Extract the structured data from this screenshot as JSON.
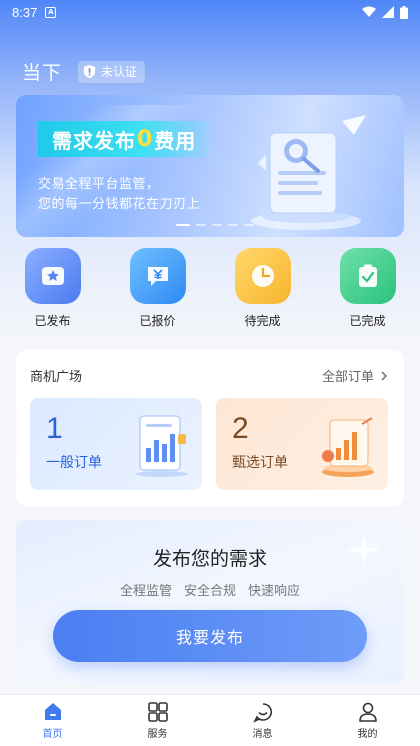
{
  "status_bar": {
    "time": "8:37",
    "badge": "A"
  },
  "header": {
    "title": "当下",
    "cert_label": "未认证"
  },
  "banner": {
    "headline_prefix": "需求发布",
    "headline_zero": "0",
    "headline_suffix": "费用",
    "line1": "交易全程平台监管，",
    "line2": "您的每一分钱都花在刀刃上"
  },
  "quick_actions": [
    {
      "label": "已发布",
      "icon": "star-box-icon"
    },
    {
      "label": "已报价",
      "icon": "yuan-chat-icon"
    },
    {
      "label": "待完成",
      "icon": "clock-icon"
    },
    {
      "label": "已完成",
      "icon": "checked-clipboard-icon"
    }
  ],
  "market": {
    "title": "商机广场",
    "all_orders": "全部订单",
    "general": {
      "count": "1",
      "label": "一般订单"
    },
    "select": {
      "count": "2",
      "label": "甄选订单"
    }
  },
  "publish": {
    "title": "发布您的需求",
    "tags": [
      "全程监管",
      "安全合规",
      "快速响应"
    ],
    "button": "我要发布"
  },
  "tabs": [
    {
      "label": "首页",
      "icon": "home-icon",
      "active": true
    },
    {
      "label": "服务",
      "icon": "grid-icon",
      "active": false
    },
    {
      "label": "消息",
      "icon": "chat-icon",
      "active": false
    },
    {
      "label": "我的",
      "icon": "user-icon",
      "active": false
    }
  ],
  "colors": {
    "primary": "#3f7af0",
    "accent_yellow": "#ffe03a",
    "headline_cyan": "#1fc9e8"
  }
}
